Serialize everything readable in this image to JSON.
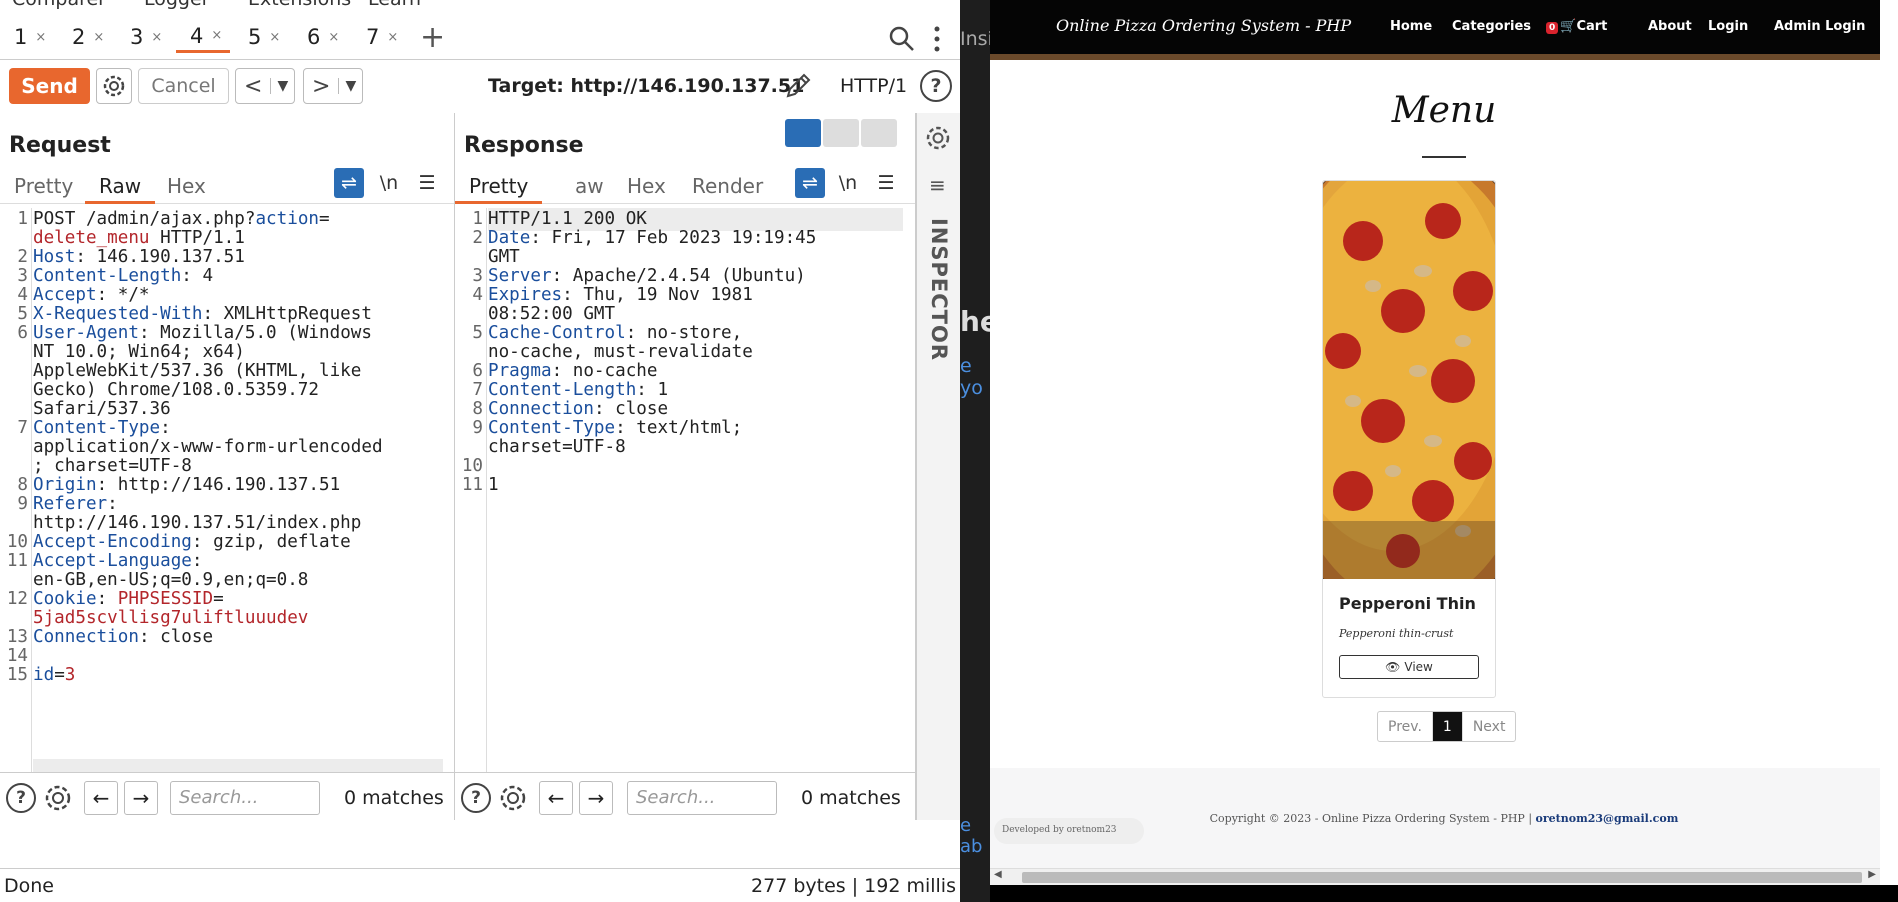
{
  "burp": {
    "menu": [
      "Comparer",
      "Logger",
      "Extensions",
      "Learn"
    ],
    "tabs": [
      {
        "label": "1",
        "close": "×"
      },
      {
        "label": "2",
        "close": "×"
      },
      {
        "label": "3",
        "close": "×"
      },
      {
        "label": "4",
        "close": "×"
      },
      {
        "label": "5",
        "close": "×"
      },
      {
        "label": "6",
        "close": "×"
      },
      {
        "label": "7",
        "close": "×"
      }
    ],
    "active_tab": "4",
    "add_tab": "+",
    "send_label": "Send",
    "cancel_label": "Cancel",
    "target_label": "Target: http://146.190.137.51",
    "http_version": "HTTP/1",
    "request": {
      "title": "Request",
      "tabs": [
        "Pretty",
        "Raw",
        "Hex"
      ],
      "active": "Raw",
      "lines": [
        {
          "n": "1",
          "parts": [
            [
              "t",
              "POST /admin/ajax.php?"
            ],
            [
              "k",
              "action"
            ],
            [
              "t",
              "="
            ]
          ]
        },
        {
          "n": "",
          "parts": [
            [
              "r",
              "delete_menu"
            ],
            [
              "t",
              " HTTP/1.1"
            ]
          ]
        },
        {
          "n": "2",
          "parts": [
            [
              "k",
              "Host"
            ],
            [
              "t",
              ": 146.190.137.51"
            ]
          ]
        },
        {
          "n": "3",
          "parts": [
            [
              "k",
              "Content-Length"
            ],
            [
              "t",
              ": 4"
            ]
          ]
        },
        {
          "n": "4",
          "parts": [
            [
              "k",
              "Accept"
            ],
            [
              "t",
              ": */*"
            ]
          ]
        },
        {
          "n": "5",
          "parts": [
            [
              "k",
              "X-Requested-With"
            ],
            [
              "t",
              ": XMLHttpRequest"
            ]
          ]
        },
        {
          "n": "6",
          "parts": [
            [
              "k",
              "User-Agent"
            ],
            [
              "t",
              ": Mozilla/5.0 (Windows"
            ]
          ]
        },
        {
          "n": "",
          "parts": [
            [
              "t",
              "NT 10.0; Win64; x64)"
            ]
          ]
        },
        {
          "n": "",
          "parts": [
            [
              "t",
              "AppleWebKit/537.36 (KHTML, like"
            ]
          ]
        },
        {
          "n": "",
          "parts": [
            [
              "t",
              "Gecko) Chrome/108.0.5359.72"
            ]
          ]
        },
        {
          "n": "",
          "parts": [
            [
              "t",
              "Safari/537.36"
            ]
          ]
        },
        {
          "n": "7",
          "parts": [
            [
              "k",
              "Content-Type"
            ],
            [
              "t",
              ":"
            ]
          ]
        },
        {
          "n": "",
          "parts": [
            [
              "t",
              "application/x-www-form-urlencoded"
            ]
          ]
        },
        {
          "n": "",
          "parts": [
            [
              "t",
              "; charset=UTF-8"
            ]
          ]
        },
        {
          "n": "8",
          "parts": [
            [
              "k",
              "Origin"
            ],
            [
              "t",
              ": http://146.190.137.51"
            ]
          ]
        },
        {
          "n": "9",
          "parts": [
            [
              "k",
              "Referer"
            ],
            [
              "t",
              ":"
            ]
          ]
        },
        {
          "n": "",
          "parts": [
            [
              "t",
              "http://146.190.137.51/index.php"
            ]
          ]
        },
        {
          "n": "10",
          "parts": [
            [
              "k",
              "Accept-Encoding"
            ],
            [
              "t",
              ": gzip, deflate"
            ]
          ]
        },
        {
          "n": "11",
          "parts": [
            [
              "k",
              "Accept-Language"
            ],
            [
              "t",
              ":"
            ]
          ]
        },
        {
          "n": "",
          "parts": [
            [
              "t",
              "en-GB,en-US;q=0.9,en;q=0.8"
            ]
          ]
        },
        {
          "n": "12",
          "parts": [
            [
              "k",
              "Cookie"
            ],
            [
              "t",
              ": "
            ],
            [
              "r",
              "PHPSESSID"
            ],
            [
              "t",
              "="
            ]
          ]
        },
        {
          "n": "",
          "parts": [
            [
              "r",
              "5jad5scvllisg7uliftluuudev"
            ]
          ]
        },
        {
          "n": "13",
          "parts": [
            [
              "k",
              "Connection"
            ],
            [
              "t",
              ": close"
            ]
          ]
        },
        {
          "n": "14",
          "parts": []
        },
        {
          "n": "15",
          "parts": [
            [
              "k",
              "id"
            ],
            [
              "t",
              "="
            ],
            [
              "r",
              "3"
            ]
          ]
        }
      ],
      "search_placeholder": "Search...",
      "matches": "0 matches"
    },
    "response": {
      "title": "Response",
      "tabs": [
        "Pretty",
        "aw",
        "Hex",
        "Render"
      ],
      "active": "Pretty",
      "lines": [
        {
          "n": "1",
          "parts": [
            [
              "t",
              "HTTP/1.1 200 OK"
            ]
          ]
        },
        {
          "n": "2",
          "parts": [
            [
              "k",
              "Date"
            ],
            [
              "t",
              ": Fri, 17 Feb 2023 19:19:45"
            ]
          ]
        },
        {
          "n": "",
          "parts": [
            [
              "t",
              "GMT"
            ]
          ]
        },
        {
          "n": "3",
          "parts": [
            [
              "k",
              "Server"
            ],
            [
              "t",
              ": Apache/2.4.54 (Ubuntu)"
            ]
          ]
        },
        {
          "n": "4",
          "parts": [
            [
              "k",
              "Expires"
            ],
            [
              "t",
              ": Thu, 19 Nov 1981"
            ]
          ]
        },
        {
          "n": "",
          "parts": [
            [
              "t",
              "08:52:00 GMT"
            ]
          ]
        },
        {
          "n": "5",
          "parts": [
            [
              "k",
              "Cache-Control"
            ],
            [
              "t",
              ": no-store,"
            ]
          ]
        },
        {
          "n": "",
          "parts": [
            [
              "t",
              "no-cache, must-revalidate"
            ]
          ]
        },
        {
          "n": "6",
          "parts": [
            [
              "k",
              "Pragma"
            ],
            [
              "t",
              ": no-cache"
            ]
          ]
        },
        {
          "n": "7",
          "parts": [
            [
              "k",
              "Content-Length"
            ],
            [
              "t",
              ": 1"
            ]
          ]
        },
        {
          "n": "8",
          "parts": [
            [
              "k",
              "Connection"
            ],
            [
              "t",
              ": close"
            ]
          ]
        },
        {
          "n": "9",
          "parts": [
            [
              "k",
              "Content-Type"
            ],
            [
              "t",
              ": text/html;"
            ]
          ]
        },
        {
          "n": "",
          "parts": [
            [
              "t",
              "charset=UTF-8"
            ]
          ]
        },
        {
          "n": "10",
          "parts": []
        },
        {
          "n": "11",
          "parts": [
            [
              "t",
              "1"
            ]
          ]
        }
      ],
      "search_placeholder": "Search...",
      "matches": "0 matches"
    },
    "inspector_label": "INSPECTOR",
    "status_left": "Done",
    "status_right": "277 bytes | 192 millis",
    "wrap_label": "\\n"
  },
  "dark_strip": [
    "Insi",
    "he",
    "e yo",
    "e ab"
  ],
  "site": {
    "brand": "Online Pizza Ordering System - PHP",
    "nav": [
      "Home",
      "Categories",
      "Cart",
      "About",
      "Login",
      "Admin Login"
    ],
    "cart_count": "0",
    "menu_title": "Menu",
    "card_title": "Pepperoni Thin",
    "card_desc": "Pepperoni thin-crust",
    "view_label": "View",
    "pagination": [
      "Prev.",
      "1",
      "Next"
    ],
    "copyright": "Copyright © 2023 - Online Pizza Ordering System - PHP |",
    "email": "oretnom23@gmail.com",
    "developed": "Developed by oretnom23"
  }
}
